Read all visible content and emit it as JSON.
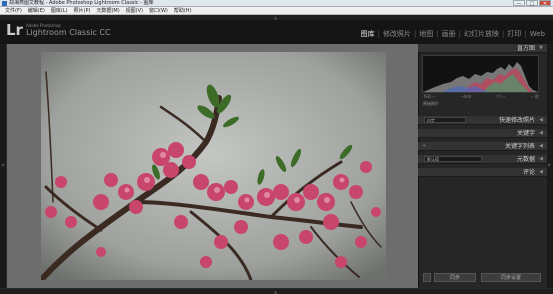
{
  "window": {
    "title": "郑海燕图文教程 - Adobe Photoshop Lightroom Classic - 图库",
    "minimize": "—",
    "maximize": "□",
    "close": "✕"
  },
  "menu": [
    "文件(F)",
    "编辑(E)",
    "图库(L)",
    "照片(P)",
    "元数据(M)",
    "视图(V)",
    "窗口(W)",
    "帮助(H)"
  ],
  "identity": {
    "logo": "Lr",
    "vendor": "Adobe Photoshop",
    "product": "Lightroom Classic CC"
  },
  "modules": [
    {
      "label": "图库",
      "active": true
    },
    {
      "label": "修改照片",
      "active": false
    },
    {
      "label": "地图",
      "active": false
    },
    {
      "label": "画册",
      "active": false
    },
    {
      "label": "幻灯片放映",
      "active": false
    },
    {
      "label": "打印",
      "active": false
    },
    {
      "label": "Web",
      "active": false
    }
  ],
  "right_panel": {
    "histogram_title": "直方图",
    "histogram_info": [
      "ISO --",
      "--mm",
      "f / --",
      "-- 秒"
    ],
    "original_photo": "原始照片",
    "quick_develop": {
      "preset": "自定",
      "title": "快速修改照片"
    },
    "keywording": "关键字",
    "keyword_list": "关键字列表",
    "metadata": {
      "preset": "默认值",
      "title": "元数据"
    },
    "comments": "评论"
  },
  "bottom": {
    "sync": "同步",
    "sync_settings": "同步设置"
  },
  "colors": {
    "accent_active": "#e6e6e6",
    "panel_bg": "#262626",
    "main_bg": "#6d6d6d"
  }
}
